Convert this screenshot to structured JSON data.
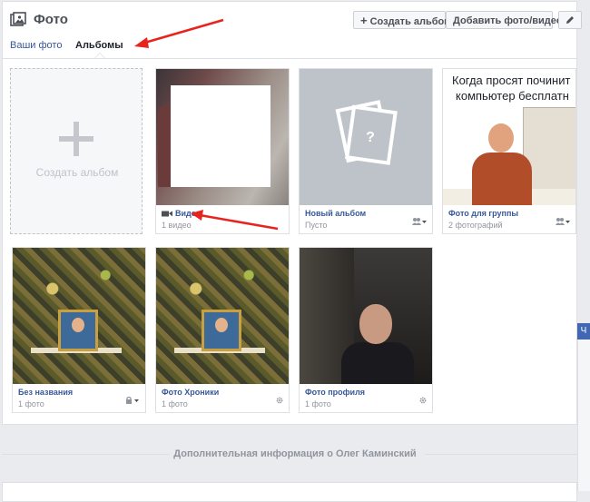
{
  "header": {
    "title": "Фото",
    "create_album_button": "Создать альбом",
    "add_button": "Добавить фото/видео",
    "tabs": [
      "Ваши фото",
      "Альбомы"
    ]
  },
  "create_tile": {
    "label": "Создать альбом"
  },
  "albums": [
    {
      "title": "Видео",
      "count": "1 видео"
    },
    {
      "title": "Новый альбом",
      "count": "Пусто"
    },
    {
      "title": "Фото для группы",
      "count": "2 фотографий",
      "thumb_caption": [
        "Когда просят починит",
        "компьютер бесплатн"
      ]
    },
    {
      "title": "Без названия",
      "count": "1 фото"
    },
    {
      "title": "Фото Хроники",
      "count": "1 фото"
    },
    {
      "title": "Фото профиля",
      "count": "1 фото"
    }
  ],
  "footer": {
    "info_title": "Дополнительная информация о Олег Каминский"
  },
  "side_tab_text": "Ч",
  "colors": {
    "accent": "#365899",
    "annotation": "#e8231e"
  }
}
